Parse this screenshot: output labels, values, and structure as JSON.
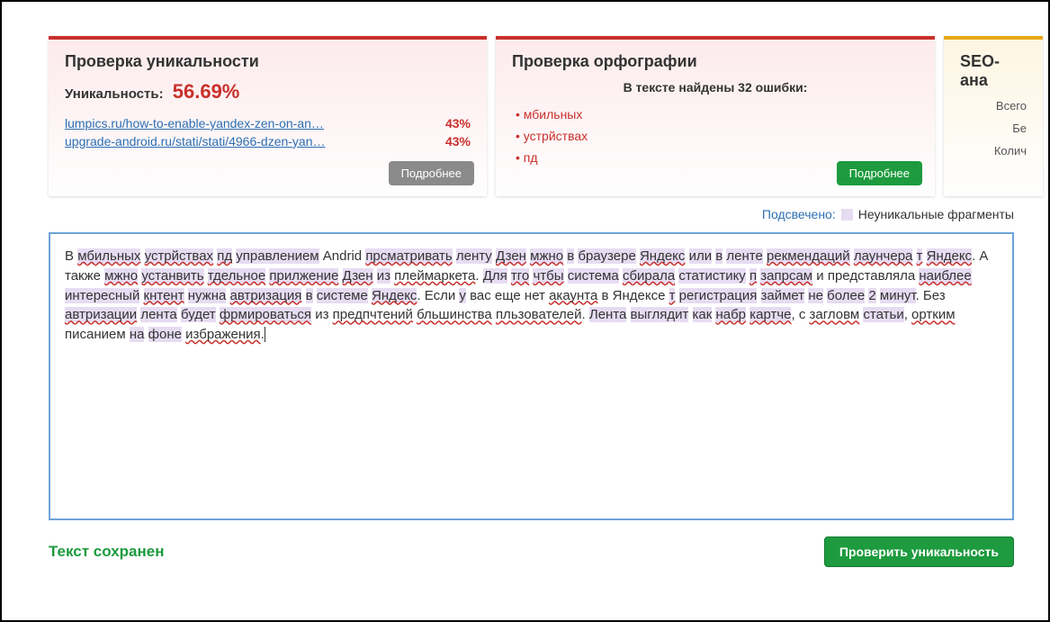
{
  "uniqueness_panel": {
    "title": "Проверка уникальности",
    "label": "Уникальность:",
    "percent": "56.69%",
    "matches": [
      {
        "url": "lumpics.ru/how-to-enable-yandex-zen-on-an…",
        "pct": "43%"
      },
      {
        "url": "upgrade-android.ru/stati/stati/4966-dzen-yan…",
        "pct": "43%"
      }
    ],
    "more": "Подробнее"
  },
  "spelling_panel": {
    "title": "Проверка орфографии",
    "subtitle": "В тексте найдены 32 ошибки:",
    "errors": [
      "мбильных",
      "устрйствах",
      "пд"
    ],
    "more": "Подробнее"
  },
  "seo_panel": {
    "title": "SEO-ана",
    "lines": [
      "Всего",
      "Бе",
      "Колич"
    ]
  },
  "legend": {
    "label": "Подсвечено:",
    "text": "Неуникальные фрагменты"
  },
  "editor_segments": [
    {
      "t": "В ",
      "hl": false,
      "sp": false
    },
    {
      "t": "мбильных",
      "hl": true,
      "sp": true
    },
    {
      "t": " ",
      "hl": false,
      "sp": false
    },
    {
      "t": "устрйствах",
      "hl": true,
      "sp": true
    },
    {
      "t": " ",
      "hl": false,
      "sp": false
    },
    {
      "t": "пд",
      "hl": true,
      "sp": true
    },
    {
      "t": " ",
      "hl": false,
      "sp": false
    },
    {
      "t": "управлением",
      "hl": true,
      "sp": false
    },
    {
      "t": " Andrid ",
      "hl": false,
      "sp": false
    },
    {
      "t": "прсматривать",
      "hl": true,
      "sp": true
    },
    {
      "t": " ",
      "hl": false,
      "sp": false
    },
    {
      "t": "ленту",
      "hl": true,
      "sp": false
    },
    {
      "t": " ",
      "hl": false,
      "sp": false
    },
    {
      "t": "Дзен",
      "hl": true,
      "sp": true
    },
    {
      "t": " ",
      "hl": false,
      "sp": false
    },
    {
      "t": "мжно",
      "hl": true,
      "sp": true
    },
    {
      "t": " ",
      "hl": false,
      "sp": false
    },
    {
      "t": "в",
      "hl": true,
      "sp": false
    },
    {
      "t": " ",
      "hl": false,
      "sp": false
    },
    {
      "t": "браузере",
      "hl": true,
      "sp": false
    },
    {
      "t": " ",
      "hl": false,
      "sp": false
    },
    {
      "t": "Яндекс",
      "hl": true,
      "sp": true
    },
    {
      "t": " ",
      "hl": false,
      "sp": false
    },
    {
      "t": "или",
      "hl": true,
      "sp": false
    },
    {
      "t": " ",
      "hl": false,
      "sp": false
    },
    {
      "t": "в",
      "hl": true,
      "sp": false
    },
    {
      "t": " ",
      "hl": false,
      "sp": false
    },
    {
      "t": "ленте",
      "hl": true,
      "sp": false
    },
    {
      "t": " ",
      "hl": false,
      "sp": false
    },
    {
      "t": "рекмендаций",
      "hl": true,
      "sp": true
    },
    {
      "t": " ",
      "hl": false,
      "sp": false
    },
    {
      "t": "лаунчера",
      "hl": true,
      "sp": true
    },
    {
      "t": " ",
      "hl": false,
      "sp": false
    },
    {
      "t": "т",
      "hl": true,
      "sp": true
    },
    {
      "t": " ",
      "hl": false,
      "sp": false
    },
    {
      "t": "Яндекс",
      "hl": true,
      "sp": true
    },
    {
      "t": ". А также ",
      "hl": false,
      "sp": false
    },
    {
      "t": "мжно",
      "hl": true,
      "sp": true
    },
    {
      "t": " ",
      "hl": false,
      "sp": false
    },
    {
      "t": "устанвить",
      "hl": true,
      "sp": true
    },
    {
      "t": " ",
      "hl": false,
      "sp": false
    },
    {
      "t": "тдельное",
      "hl": true,
      "sp": true
    },
    {
      "t": " ",
      "hl": false,
      "sp": false
    },
    {
      "t": "прилжение",
      "hl": true,
      "sp": true
    },
    {
      "t": " ",
      "hl": false,
      "sp": false
    },
    {
      "t": "Дзен",
      "hl": true,
      "sp": true
    },
    {
      "t": " ",
      "hl": false,
      "sp": false
    },
    {
      "t": "из",
      "hl": true,
      "sp": false
    },
    {
      "t": " ",
      "hl": false,
      "sp": false
    },
    {
      "t": "плеймаркета",
      "hl": false,
      "sp": true
    },
    {
      "t": ". ",
      "hl": false,
      "sp": false
    },
    {
      "t": "Для",
      "hl": true,
      "sp": false
    },
    {
      "t": " ",
      "hl": false,
      "sp": false
    },
    {
      "t": "тго",
      "hl": true,
      "sp": true
    },
    {
      "t": " ",
      "hl": false,
      "sp": false
    },
    {
      "t": "чтбы",
      "hl": true,
      "sp": true
    },
    {
      "t": " ",
      "hl": false,
      "sp": false
    },
    {
      "t": "система",
      "hl": true,
      "sp": false
    },
    {
      "t": " ",
      "hl": false,
      "sp": false
    },
    {
      "t": "сбирала",
      "hl": true,
      "sp": true
    },
    {
      "t": " ",
      "hl": false,
      "sp": false
    },
    {
      "t": "статистику",
      "hl": true,
      "sp": false
    },
    {
      "t": " ",
      "hl": false,
      "sp": false
    },
    {
      "t": "п",
      "hl": true,
      "sp": true
    },
    {
      "t": " ",
      "hl": false,
      "sp": false
    },
    {
      "t": "запрсам",
      "hl": true,
      "sp": true
    },
    {
      "t": " и представляла ",
      "hl": false,
      "sp": false
    },
    {
      "t": "наиблее",
      "hl": true,
      "sp": true
    },
    {
      "t": " ",
      "hl": false,
      "sp": false
    },
    {
      "t": "интересный",
      "hl": true,
      "sp": false
    },
    {
      "t": " ",
      "hl": false,
      "sp": false
    },
    {
      "t": "кнтент",
      "hl": true,
      "sp": true
    },
    {
      "t": " ",
      "hl": false,
      "sp": false
    },
    {
      "t": "нужна",
      "hl": true,
      "sp": false
    },
    {
      "t": " ",
      "hl": false,
      "sp": false
    },
    {
      "t": "автризация",
      "hl": true,
      "sp": true
    },
    {
      "t": " ",
      "hl": false,
      "sp": false
    },
    {
      "t": "в",
      "hl": true,
      "sp": false
    },
    {
      "t": " ",
      "hl": false,
      "sp": false
    },
    {
      "t": "системе",
      "hl": true,
      "sp": false
    },
    {
      "t": " ",
      "hl": false,
      "sp": false
    },
    {
      "t": "Яндекс",
      "hl": true,
      "sp": true
    },
    {
      "t": ". Если ",
      "hl": false,
      "sp": false
    },
    {
      "t": "у",
      "hl": true,
      "sp": false
    },
    {
      "t": " вас еще нет ",
      "hl": false,
      "sp": false
    },
    {
      "t": "акаунта",
      "hl": false,
      "sp": true
    },
    {
      "t": " в Яндексе ",
      "hl": false,
      "sp": false
    },
    {
      "t": "т",
      "hl": true,
      "sp": true
    },
    {
      "t": " ",
      "hl": false,
      "sp": false
    },
    {
      "t": "регистрация",
      "hl": true,
      "sp": false
    },
    {
      "t": " ",
      "hl": false,
      "sp": false
    },
    {
      "t": "займет",
      "hl": true,
      "sp": false
    },
    {
      "t": " ",
      "hl": false,
      "sp": false
    },
    {
      "t": "не",
      "hl": true,
      "sp": false
    },
    {
      "t": " ",
      "hl": false,
      "sp": false
    },
    {
      "t": "более",
      "hl": true,
      "sp": false
    },
    {
      "t": " ",
      "hl": false,
      "sp": false
    },
    {
      "t": "2",
      "hl": true,
      "sp": false
    },
    {
      "t": " ",
      "hl": false,
      "sp": false
    },
    {
      "t": "минут",
      "hl": true,
      "sp": false
    },
    {
      "t": ". Без ",
      "hl": false,
      "sp": false
    },
    {
      "t": "автризации",
      "hl": true,
      "sp": true
    },
    {
      "t": " ",
      "hl": false,
      "sp": false
    },
    {
      "t": "лента",
      "hl": true,
      "sp": false
    },
    {
      "t": " ",
      "hl": false,
      "sp": false
    },
    {
      "t": "будет",
      "hl": true,
      "sp": false
    },
    {
      "t": " ",
      "hl": false,
      "sp": false
    },
    {
      "t": "фрмироваться",
      "hl": true,
      "sp": true
    },
    {
      "t": " из ",
      "hl": false,
      "sp": false
    },
    {
      "t": "предпчтений",
      "hl": false,
      "sp": true
    },
    {
      "t": " ",
      "hl": false,
      "sp": false
    },
    {
      "t": "бльшинства",
      "hl": false,
      "sp": true
    },
    {
      "t": " ",
      "hl": false,
      "sp": false
    },
    {
      "t": "пльзователей",
      "hl": false,
      "sp": true
    },
    {
      "t": ". ",
      "hl": false,
      "sp": false
    },
    {
      "t": "Лента",
      "hl": true,
      "sp": false
    },
    {
      "t": " ",
      "hl": false,
      "sp": false
    },
    {
      "t": "выглядит",
      "hl": true,
      "sp": false
    },
    {
      "t": " ",
      "hl": false,
      "sp": false
    },
    {
      "t": "как",
      "hl": true,
      "sp": false
    },
    {
      "t": " ",
      "hl": false,
      "sp": false
    },
    {
      "t": "набр",
      "hl": true,
      "sp": true
    },
    {
      "t": " ",
      "hl": false,
      "sp": false
    },
    {
      "t": "картче",
      "hl": true,
      "sp": true
    },
    {
      "t": ", с ",
      "hl": false,
      "sp": false
    },
    {
      "t": "загловм",
      "hl": false,
      "sp": true
    },
    {
      "t": " ",
      "hl": false,
      "sp": false
    },
    {
      "t": "статьи",
      "hl": true,
      "sp": false
    },
    {
      "t": ", ",
      "hl": false,
      "sp": false
    },
    {
      "t": "ортким",
      "hl": false,
      "sp": true
    },
    {
      "t": " писанием ",
      "hl": false,
      "sp": false
    },
    {
      "t": "на",
      "hl": true,
      "sp": false
    },
    {
      "t": " ",
      "hl": false,
      "sp": false
    },
    {
      "t": "фоне",
      "hl": true,
      "sp": false
    },
    {
      "t": " ",
      "hl": false,
      "sp": false
    },
    {
      "t": "избражения",
      "hl": false,
      "sp": true
    },
    {
      "t": ".",
      "hl": false,
      "sp": false
    }
  ],
  "bottom": {
    "saved": "Текст сохранен",
    "check_button": "Проверить уникальность"
  }
}
